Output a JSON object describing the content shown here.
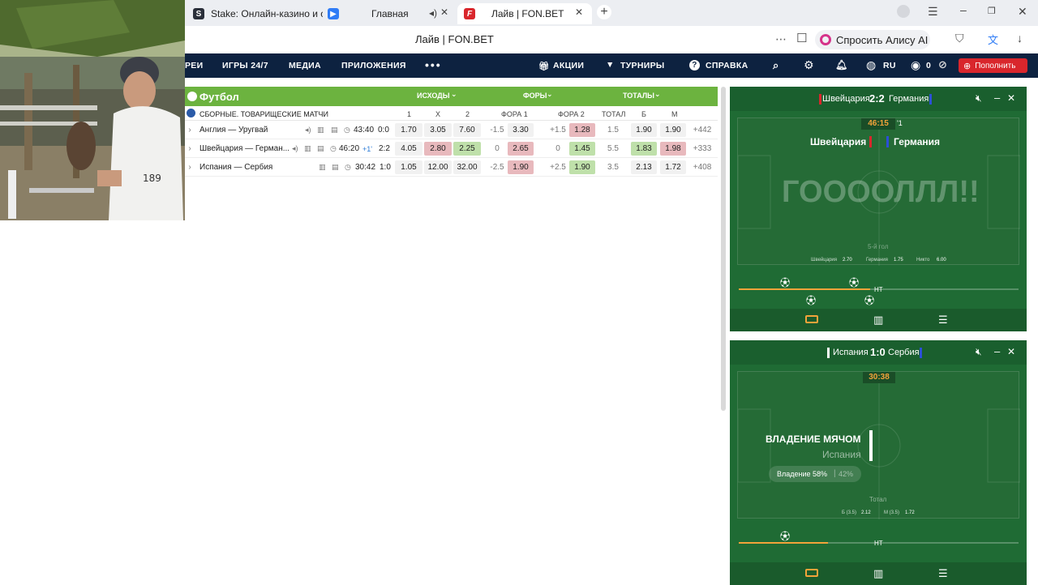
{
  "browser": {
    "tabs": [
      {
        "label": "Stake: Онлайн-казино и с",
        "icon": "stake-icon"
      },
      {
        "label": "Главная",
        "icon": "video-icon"
      },
      {
        "label": "Лайв | FON.BET",
        "icon": "fonbet-icon"
      }
    ],
    "page_title": "Лайв | FON.BET",
    "alice_button": "Спросить Алису AI"
  },
  "site_nav": {
    "items": [
      "РЕИ",
      "ИГРЫ 24/7",
      "МЕДИА",
      "ПРИЛОЖЕНИЯ"
    ],
    "right_items": [
      "АКЦИИ",
      "ТУРНИРЫ",
      "СПРАВКА"
    ],
    "language": "RU",
    "balance": "0",
    "deposit_label": "Пополнить"
  },
  "table": {
    "sport": "Футбол",
    "groups": [
      "ИСХОДЫ",
      "ФОРЫ",
      "ТОТАЛЫ"
    ],
    "league": "СБОРНЫЕ. ТОВАРИЩЕСКИЕ МАТЧИ",
    "columns": [
      "1",
      "X",
      "2",
      "ФОРА 1",
      "ФОРА 2",
      "ТОТАЛ",
      "Б",
      "М"
    ],
    "rows": [
      {
        "teams": "Англия — Уругвай",
        "time": "43:40",
        "score": "0:0",
        "badge": "",
        "o1": "1.70",
        "ox": "3.05",
        "o2": "7.60",
        "h1": "-1.5",
        "h1o": "3.30",
        "h2": "+1.5",
        "h2o": "1.28",
        "total": "1.5",
        "over": "1.90",
        "under": "1.90",
        "more": "+442"
      },
      {
        "teams": "Швейцария — Герман...",
        "time": "46:20",
        "score": "2:2",
        "badge": "+1'",
        "o1": "4.05",
        "ox": "2.80",
        "o2": "2.25",
        "h1": "0",
        "h1o": "2.65",
        "h2": "0",
        "h2o": "1.45",
        "total": "5.5",
        "over": "1.83",
        "under": "1.98",
        "more": "+333"
      },
      {
        "teams": "Испания — Сербия",
        "time": "30:42",
        "score": "1:0",
        "badge": "",
        "o1": "1.05",
        "ox": "12.00",
        "o2": "32.00",
        "h1": "-2.5",
        "h1o": "1.90",
        "h2": "+2.5",
        "h2o": "1.90",
        "total": "3.5",
        "over": "2.13",
        "under": "1.72",
        "more": "+408"
      }
    ]
  },
  "widget1": {
    "home": "Швейцария",
    "away": "Германия",
    "score": "2:2",
    "clock": "46:15",
    "period": "'1",
    "banner": "ГООООЛЛЛ!!",
    "event": "5-й гол",
    "odds": [
      {
        "label": "Швейцария",
        "value": "2.70"
      },
      {
        "label": "Германия",
        "value": "1.75"
      },
      {
        "label": "Никто",
        "value": "6.00"
      }
    ],
    "timeline_label": "HT"
  },
  "widget2": {
    "home": "Испания",
    "away": "Сербия",
    "score": "1:0",
    "clock": "30:38",
    "stat_title": "ВЛАДЕНИЕ МЯЧОМ",
    "stat_team": "Испания",
    "possession_label": "Владение 58%",
    "possession_other": "42%",
    "total_label": "Тотал",
    "total_over": "Б (3.5)",
    "total_over_val": "2.12",
    "total_under": "М (3.5)",
    "total_under_val": "1.72",
    "timeline_label": "HT"
  },
  "colors": {
    "nav_bg": "#0d2240",
    "sport_header": "#6cb33f",
    "deposit": "#d9262c",
    "widget_bg": "#1f6b34",
    "clock_accent": "#f2a33a"
  }
}
